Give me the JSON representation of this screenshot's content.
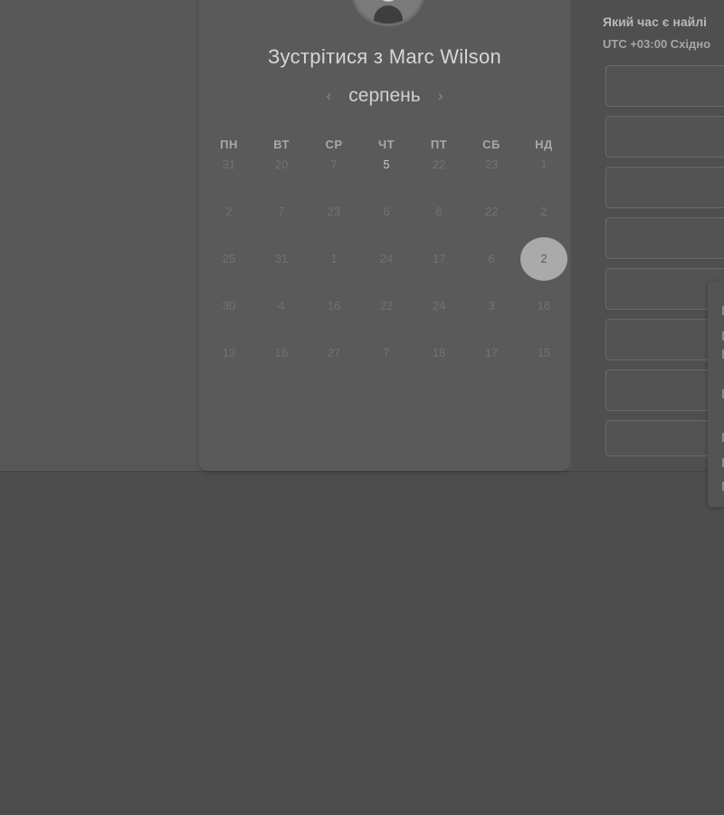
{
  "calendar": {
    "title": "Зустрітися з Marc Wilson",
    "month": "серпень",
    "prev_icon": "chevron-left-icon",
    "next_icon": "chevron-right-icon",
    "weekdays": [
      "ПН",
      "ВТ",
      "СР",
      "ЧТ",
      "ПТ",
      "СБ",
      "НД"
    ],
    "weeks": [
      [
        "31",
        "20",
        "7",
        "5",
        "22",
        "23",
        "1"
      ],
      [
        "2",
        "7",
        "23",
        "6",
        "6",
        "22",
        "2"
      ],
      [
        "25",
        "31",
        "1",
        "24",
        "17",
        "6",
        "2"
      ],
      [
        "30",
        "4",
        "16",
        "22",
        "24",
        "3",
        "16"
      ],
      [
        "13",
        "16",
        "27",
        "7",
        "18",
        "17",
        "15"
      ]
    ],
    "active_day": "5",
    "selected_day": "2"
  },
  "time_panel": {
    "question": "Який час є найлі",
    "timezone": "UTC +03:00 Східно"
  },
  "colors": {
    "background": "#4d4d4d",
    "card": "#5a5a5a",
    "selected_circle": "#aaaaaa"
  }
}
